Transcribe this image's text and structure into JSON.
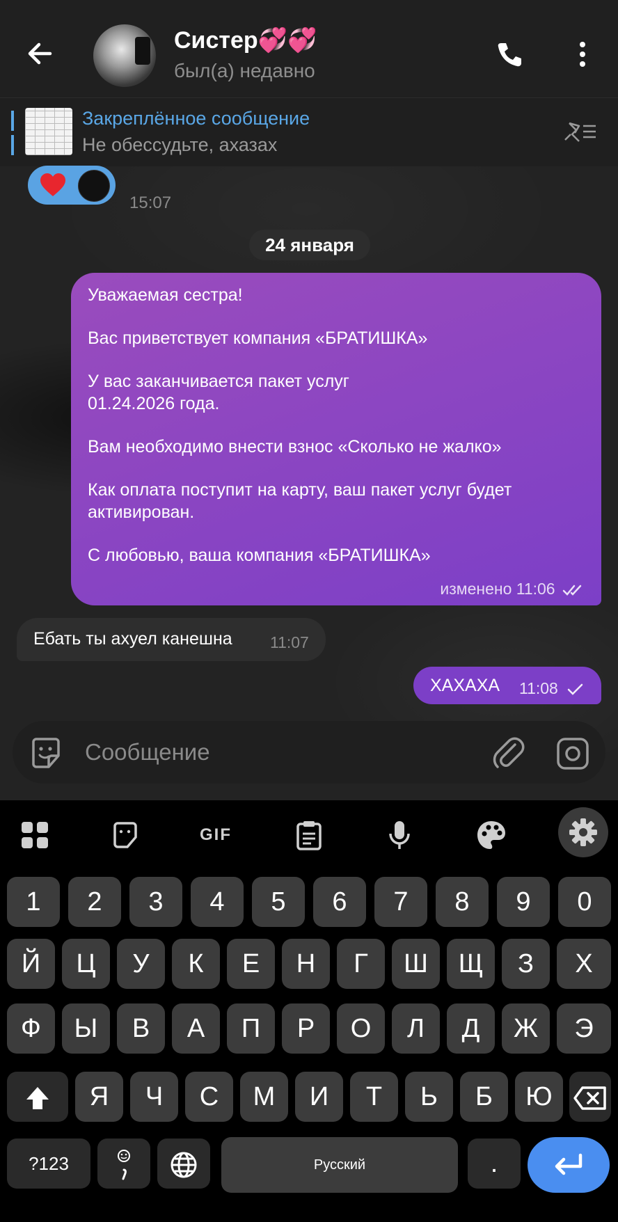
{
  "header": {
    "contact_name": "Систер💞💞",
    "status": "был(а) недавно"
  },
  "pinned": {
    "title": "Закреплённое сообщение",
    "text": "Не обессудьте, ахазах"
  },
  "reaction": {
    "emoji": "heart-icon",
    "time": "15:07"
  },
  "date_chip": "24 января",
  "messages": [
    {
      "direction": "out",
      "lines": [
        "Уважаемая сестра!",
        "",
        "Вас приветствует компания «БРАТИШКА»",
        "",
        "У вас заканчивается пакет услуг",
        "01.24.2026 года.",
        "",
        "Вам необходимо внести взнос «Сколько не жалко»",
        "",
        "Как оплата поступит на карту, ваш пакет услуг будет",
        "активирован.",
        "",
        "С любовью, ваша компания «БРАТИШКА»"
      ],
      "meta": "изменено 11:06",
      "status_icon": "double-check-icon"
    },
    {
      "direction": "in",
      "text": "Ебать ты ахуел канешна",
      "time": "11:07"
    },
    {
      "direction": "out",
      "text": "ХАХАХА",
      "time": "11:08",
      "status_icon": "single-check-icon"
    }
  ],
  "input": {
    "placeholder": "Сообщение"
  },
  "keyboard": {
    "toolbar": [
      "apps-icon",
      "sticker-icon",
      "GIF",
      "clipboard-icon",
      "mic-icon",
      "palette-icon",
      "gear-icon"
    ],
    "row_numbers": [
      "1",
      "2",
      "3",
      "4",
      "5",
      "6",
      "7",
      "8",
      "9",
      "0"
    ],
    "row1": [
      "Й",
      "Ц",
      "У",
      "К",
      "Е",
      "Н",
      "Г",
      "Ш",
      "Щ",
      "З",
      "Х"
    ],
    "row2": [
      "Ф",
      "Ы",
      "В",
      "А",
      "П",
      "Р",
      "О",
      "Л",
      "Д",
      "Ж",
      "Э"
    ],
    "row3": [
      "Я",
      "Ч",
      "С",
      "М",
      "И",
      "Т",
      "Ь",
      "Б",
      "Ю"
    ],
    "symbols_key": "?123",
    "space_label": "Русский",
    "period": "."
  },
  "colors": {
    "accent_blue": "#5aa7e6",
    "outgoing_bubble": "#7c3fc7",
    "enter_key": "#4a8ef0"
  }
}
